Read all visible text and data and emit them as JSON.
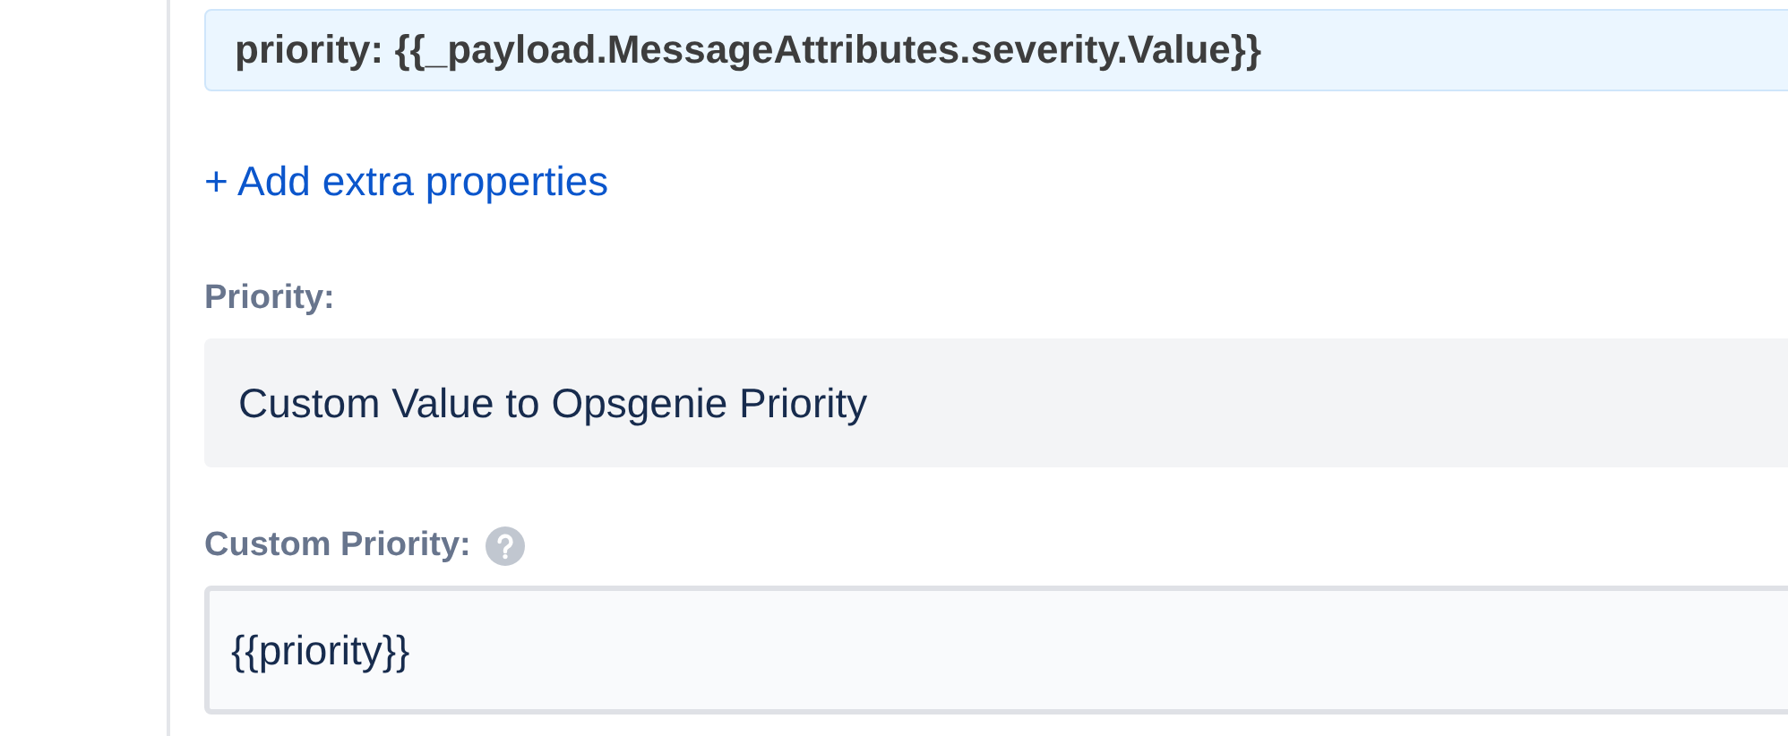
{
  "properties_field": {
    "value": "priority: {{_payload.MessageAttributes.severity.Value}}"
  },
  "add_link": "+ Add extra properties",
  "priority": {
    "label": "Priority:",
    "value": "Custom Value to Opsgenie Priority"
  },
  "custom_priority": {
    "label": "Custom Priority:",
    "value": "{{priority}}"
  }
}
